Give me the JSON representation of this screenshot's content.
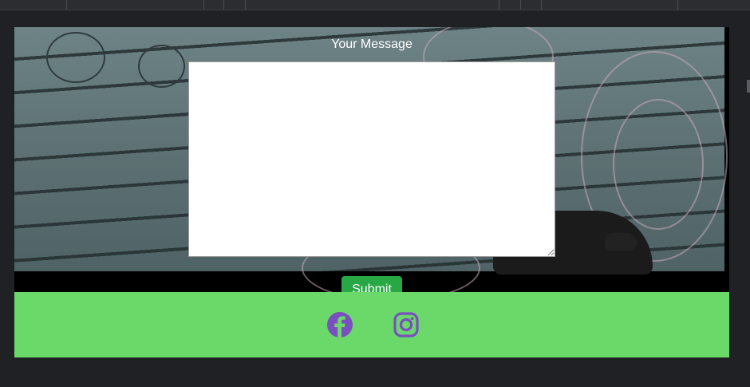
{
  "form": {
    "message_label": "Your Message",
    "message_value": "",
    "submit_label": "Submit"
  },
  "footer": {
    "links": [
      {
        "icon": "facebook-icon"
      },
      {
        "icon": "instagram-icon"
      }
    ]
  },
  "colors": {
    "footer_bg": "#6bd96a",
    "submit_bg": "#28a745",
    "icon_color": "#7a4fbf",
    "page_bg": "#202124"
  }
}
